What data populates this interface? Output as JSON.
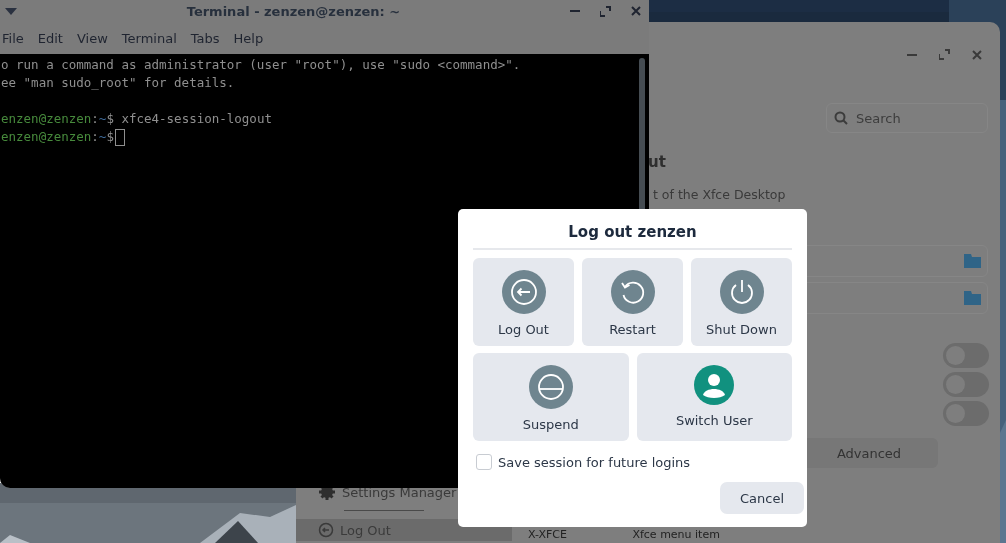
{
  "terminal": {
    "title": "Terminal - zenzen@zenzen: ~",
    "menu": [
      "File",
      "Edit",
      "View",
      "Terminal",
      "Tabs",
      "Help"
    ],
    "lines": [
      {
        "kind": "text",
        "text": "o run a command as administrator (user \"root\"), use \"sudo <command>\"."
      },
      {
        "kind": "text",
        "text": "ee \"man sudo_root\" for details."
      },
      {
        "kind": "blank"
      },
      {
        "kind": "prompt",
        "user": "enzen@zenzen",
        "separator": ":",
        "path": "~",
        "symbol": "$",
        "command": "xfce4-session-logout",
        "cursor": false
      },
      {
        "kind": "prompt",
        "user": "enzen@zenzen",
        "separator": ":",
        "path": "~",
        "symbol": "$",
        "cursor": true
      }
    ]
  },
  "settings": {
    "search": {
      "placeholder": "Search"
    },
    "heading": "ut",
    "description": "t of the Xfce Desktop",
    "fields": [
      {
        "kind": "folder"
      },
      {
        "kind": "folder"
      }
    ],
    "toggles": [
      {
        "on": false
      },
      {
        "on": false
      },
      {
        "on": false
      }
    ],
    "advanced_button": "Advanced",
    "sidebar": [
      {
        "label": "Settings Manager",
        "selected": false
      },
      {
        "label": "Log Out",
        "selected": true
      }
    ],
    "row": [
      "X-XFCE",
      "Xfce menu item"
    ]
  },
  "dialog": {
    "title": "Log out zenzen",
    "actions": [
      {
        "kind": "logout",
        "label": "Log Out"
      },
      {
        "kind": "restart",
        "label": "Restart"
      },
      {
        "kind": "shutdown",
        "label": "Shut Down"
      },
      {
        "kind": "suspend",
        "label": "Suspend"
      },
      {
        "kind": "switch",
        "label": "Switch User"
      }
    ],
    "save_session": {
      "label": "Save session for future logins",
      "checked": false
    },
    "cancel": "Cancel"
  }
}
